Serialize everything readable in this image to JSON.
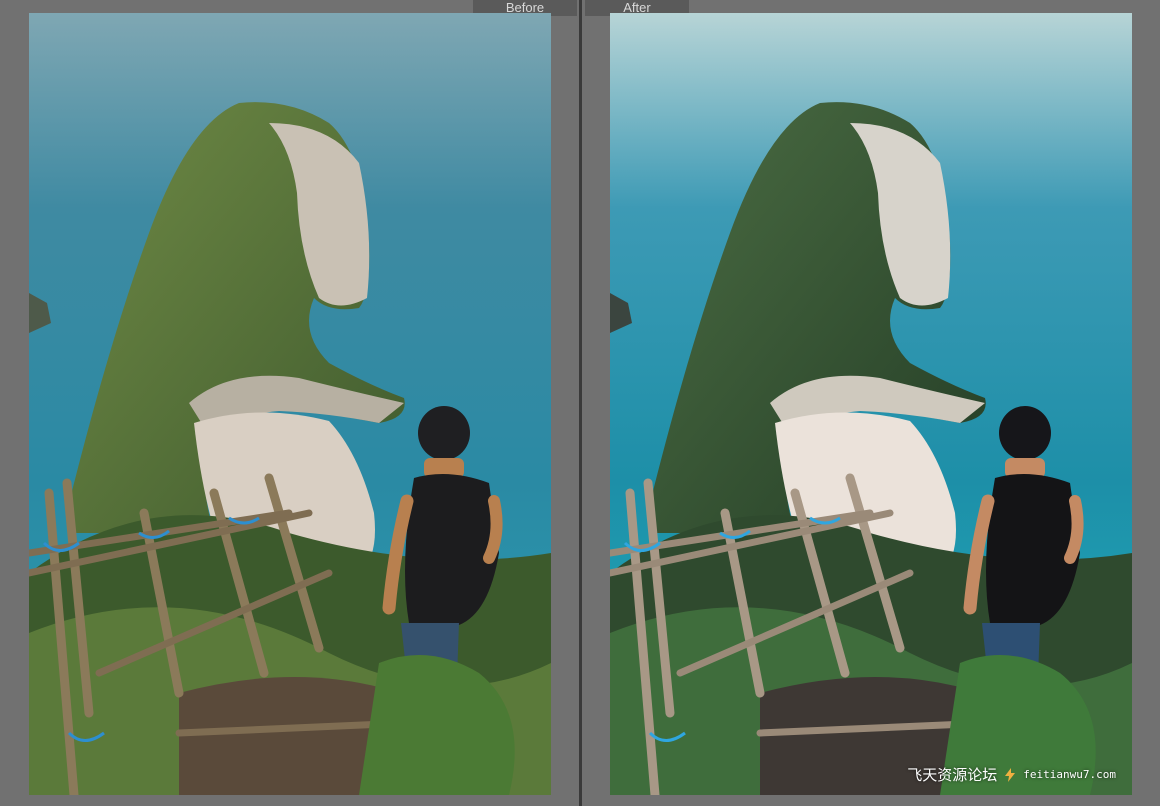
{
  "compare_view": {
    "before_label": "Before",
    "after_label": "After"
  },
  "watermark": {
    "site_name": "飞天资源论坛",
    "site_url": "feitianwu7.com"
  },
  "photos": {
    "before": {
      "icon": "landscape-photo",
      "tone": "muted"
    },
    "after": {
      "icon": "landscape-photo",
      "tone": "teal-vivid"
    }
  },
  "colors": {
    "workspace_bg": "#717171",
    "label_bg": "#5a5a5a",
    "label_text": "#d8d8d8",
    "sea_before": "#2f7f96",
    "sea_after": "#1d8fa8"
  }
}
